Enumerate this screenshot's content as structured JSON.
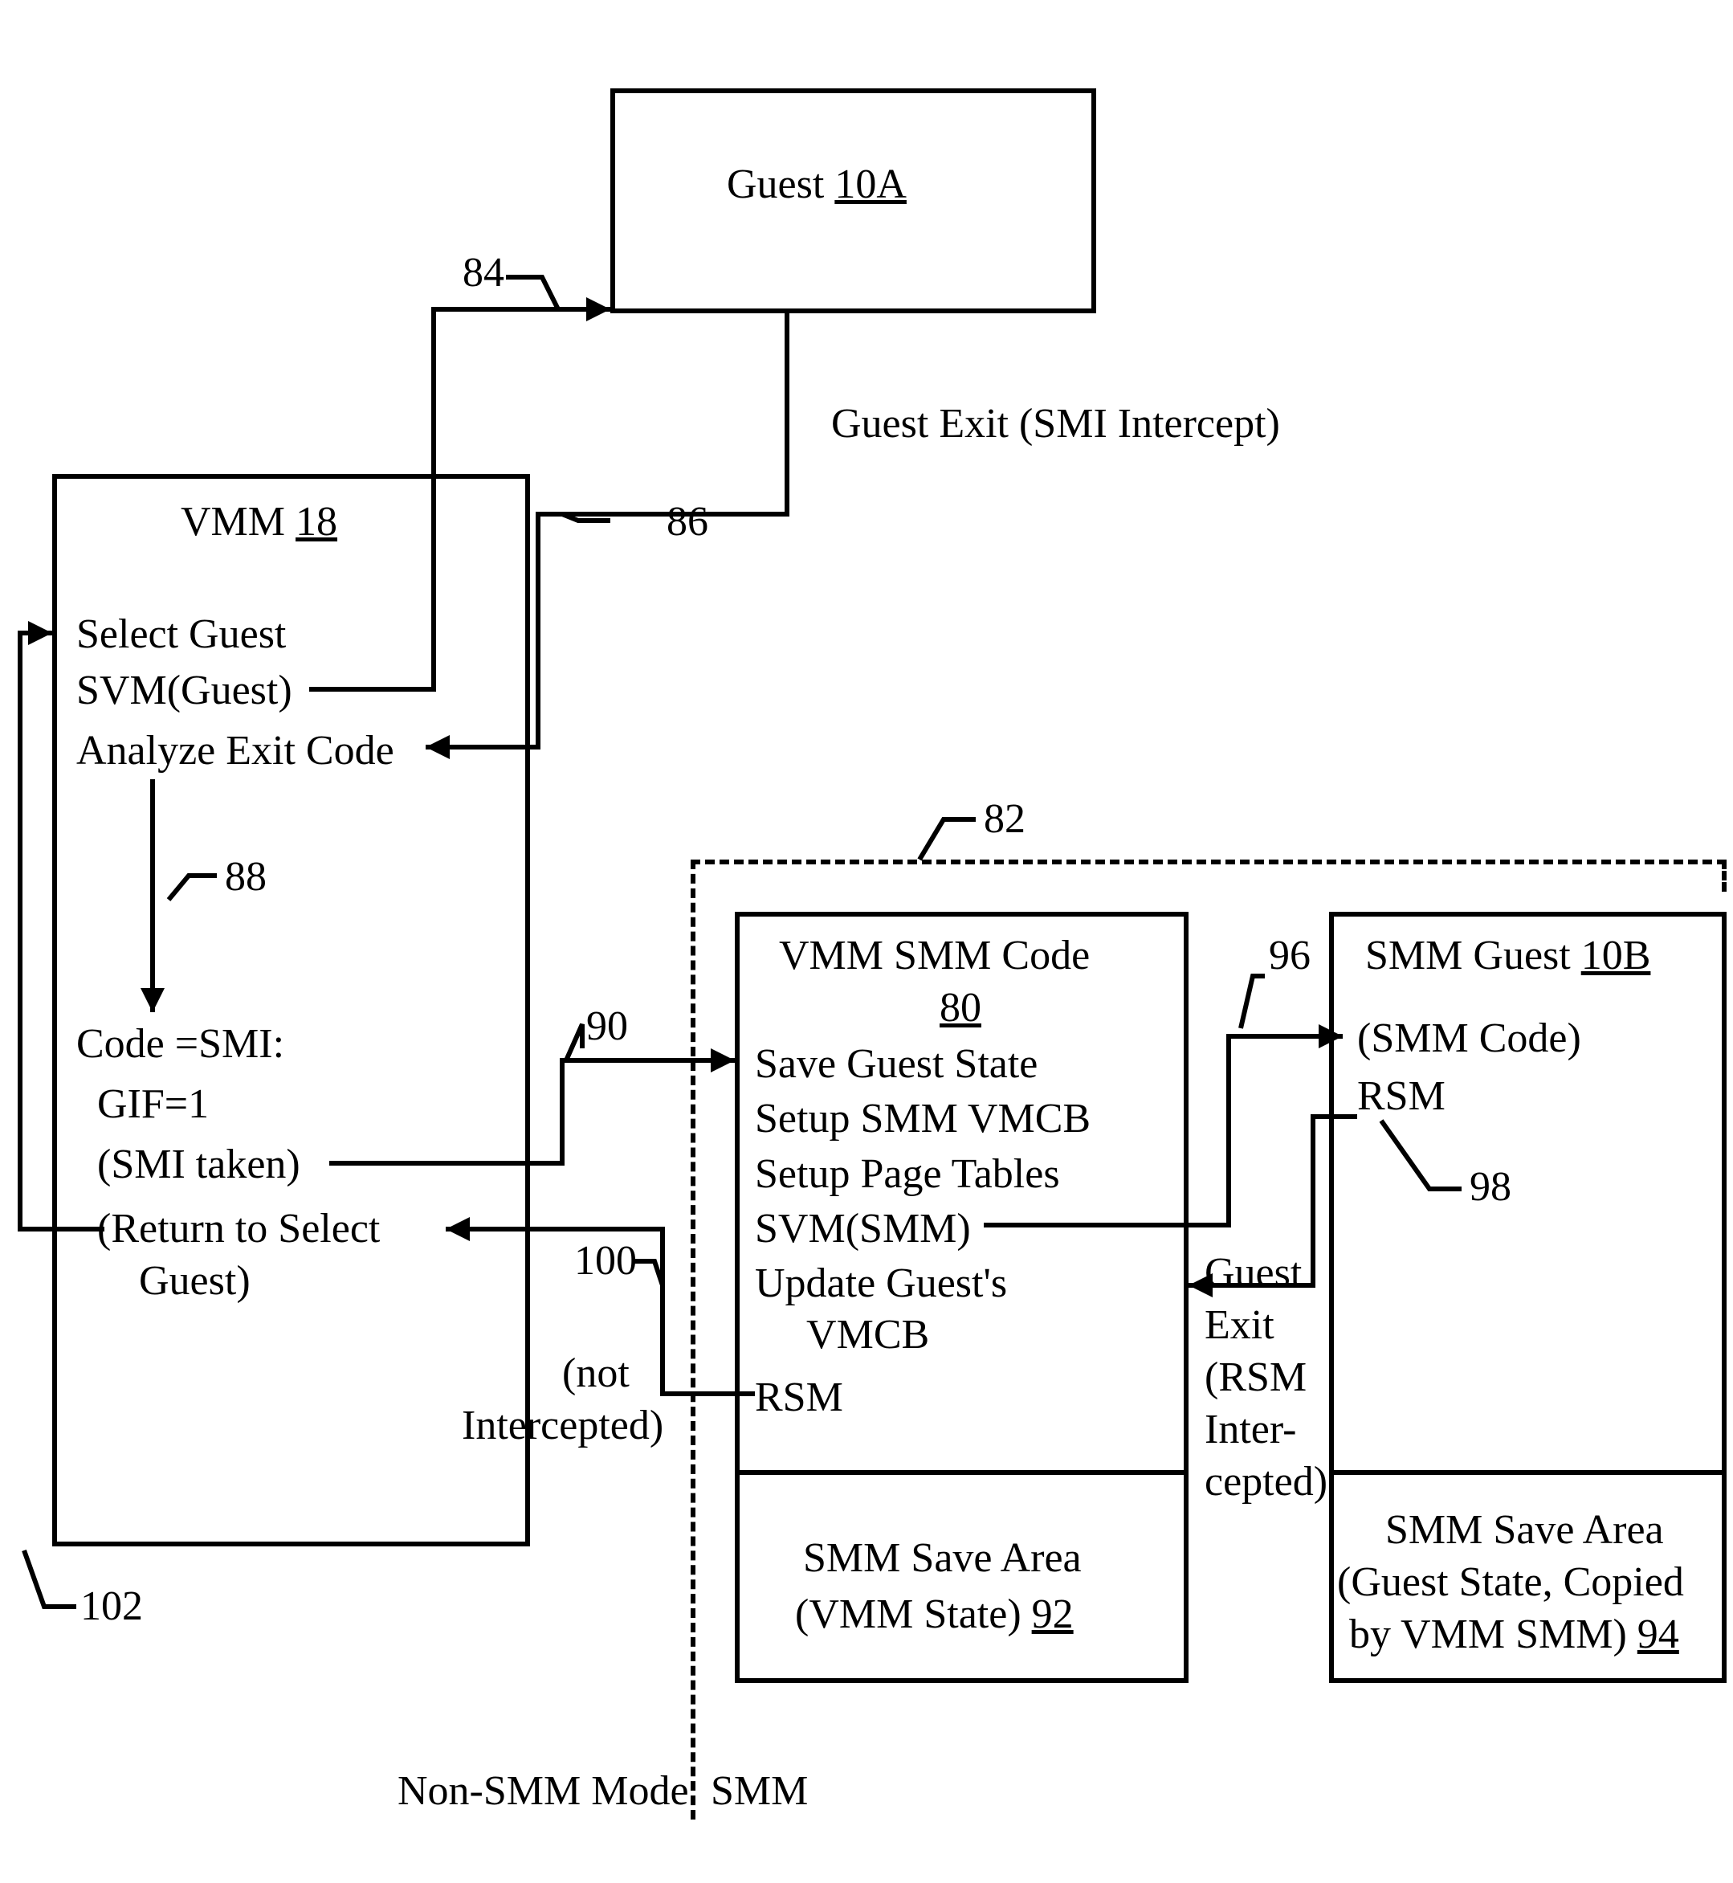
{
  "guest": {
    "title": "Guest",
    "ref": "10A"
  },
  "guest_exit_label": "Guest Exit (SMI Intercept)",
  "vmm": {
    "title": "VMM",
    "ref": "18",
    "lines": {
      "select_guest": "Select Guest",
      "svm_guest": "SVM(Guest)",
      "analyze": "Analyze Exit Code",
      "code_smi": "Code =SMI:",
      "gif1": "  GIF=1",
      "smi_taken": "  (SMI taken)",
      "return_sel": "  (Return to Select",
      "return_sel2": "      Guest)"
    }
  },
  "vmm_smm": {
    "title": "VMM SMM Code",
    "ref": "80",
    "lines": {
      "save": "Save Guest State",
      "setup_vmcb": "Setup SMM VMCB",
      "setup_pt": "Setup Page Tables",
      "svm_smm": "SVM(SMM)",
      "update1": "Update Guest's",
      "update2": "     VMCB",
      "rsm": "RSM"
    },
    "save_area": {
      "title": "SMM Save Area",
      "sub": "(VMM State)",
      "ref": "92"
    }
  },
  "smm_guest": {
    "title": "SMM Guest",
    "ref": "10B",
    "lines": {
      "code": "(SMM Code)",
      "rsm": "RSM"
    },
    "save_area": {
      "title": "SMM Save Area",
      "sub1": "(Guest State, Copied",
      "sub2": "by VMM SMM)",
      "ref": "94"
    }
  },
  "mid_labels": {
    "not_intercepted1": "(not",
    "not_intercepted2": "Intercepted)",
    "guest_exit_rsm1": "Guest",
    "guest_exit_rsm2": "Exit",
    "guest_exit_rsm3": "(RSM",
    "guest_exit_rsm4": "Inter-",
    "guest_exit_rsm5": "cepted)"
  },
  "refs": {
    "r84": "84",
    "r86": "86",
    "r88": "88",
    "r90": "90",
    "r96": "96",
    "r98": "98",
    "r100": "100",
    "r102": "102",
    "r82": "82"
  },
  "mode": {
    "left": "Non-SMM Mode",
    "right": "SMM"
  }
}
